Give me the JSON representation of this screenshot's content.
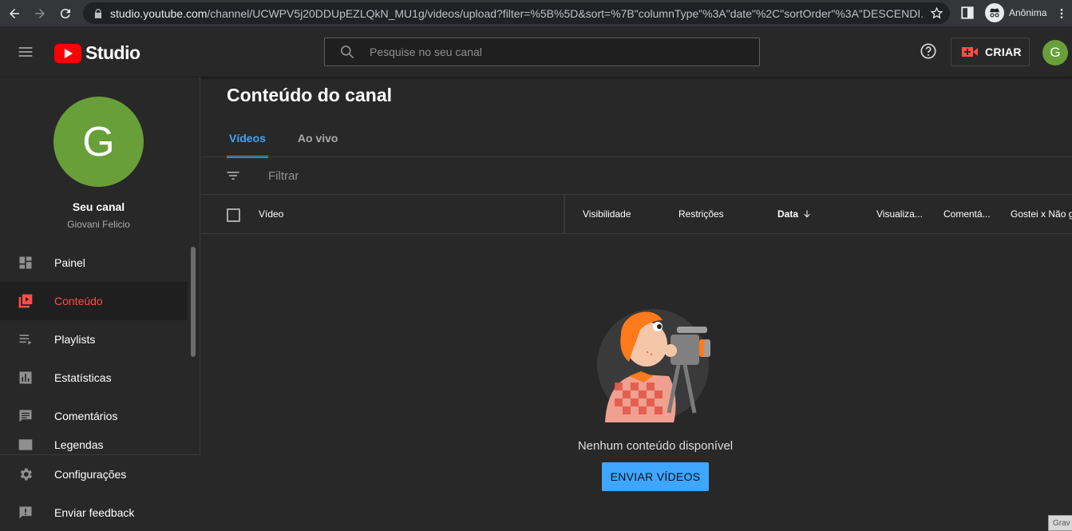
{
  "browser": {
    "url_host": "studio.youtube.com",
    "url_path": "/channel/UCWPV5j20DDUpEZLQkN_MU1g/videos/upload?filter=%5B%5D&sort=%7B\"columnType\"%3A\"date\"%2C\"sortOrder\"%3A\"DESCENDI...",
    "profile_label": "Anônima"
  },
  "header": {
    "logo_text": "Studio",
    "search_placeholder": "Pesquise no seu canal",
    "create_label": "CRIAR",
    "avatar_letter": "G"
  },
  "sidebar": {
    "avatar_letter": "G",
    "channel_title": "Seu canal",
    "channel_user": "Giovani Felicio",
    "items": [
      {
        "label": "Painel",
        "icon": "dashboard-icon"
      },
      {
        "label": "Conteúdo",
        "icon": "content-icon",
        "active": true
      },
      {
        "label": "Playlists",
        "icon": "playlist-icon"
      },
      {
        "label": "Estatísticas",
        "icon": "analytics-icon"
      },
      {
        "label": "Comentários",
        "icon": "comments-icon"
      },
      {
        "label": "Legendas",
        "icon": "subtitles-icon"
      }
    ],
    "bottom_items": [
      {
        "label": "Configurações",
        "icon": "gear-icon"
      },
      {
        "label": "Enviar feedback",
        "icon": "feedback-icon"
      }
    ]
  },
  "main": {
    "title": "Conteúdo do canal",
    "tabs": [
      {
        "label": "Vídeos",
        "active": true
      },
      {
        "label": "Ao vivo"
      }
    ],
    "filter_placeholder": "Filtrar",
    "columns": {
      "video": "Vídeo",
      "visibility": "Visibilidade",
      "restrictions": "Restrições",
      "date": "Data",
      "views": "Visualiza...",
      "comments": "Comentá...",
      "likes": "Gostei x Não g"
    },
    "empty_message": "Nenhum conteúdo disponível",
    "upload_button": "ENVIAR VÍDEOS"
  },
  "overlay_label": "Grav",
  "colors": {
    "accent_blue": "#3ea6ff",
    "active_red": "#ff4e45",
    "avatar_green": "#689f38",
    "brand_red": "#ff0000"
  }
}
